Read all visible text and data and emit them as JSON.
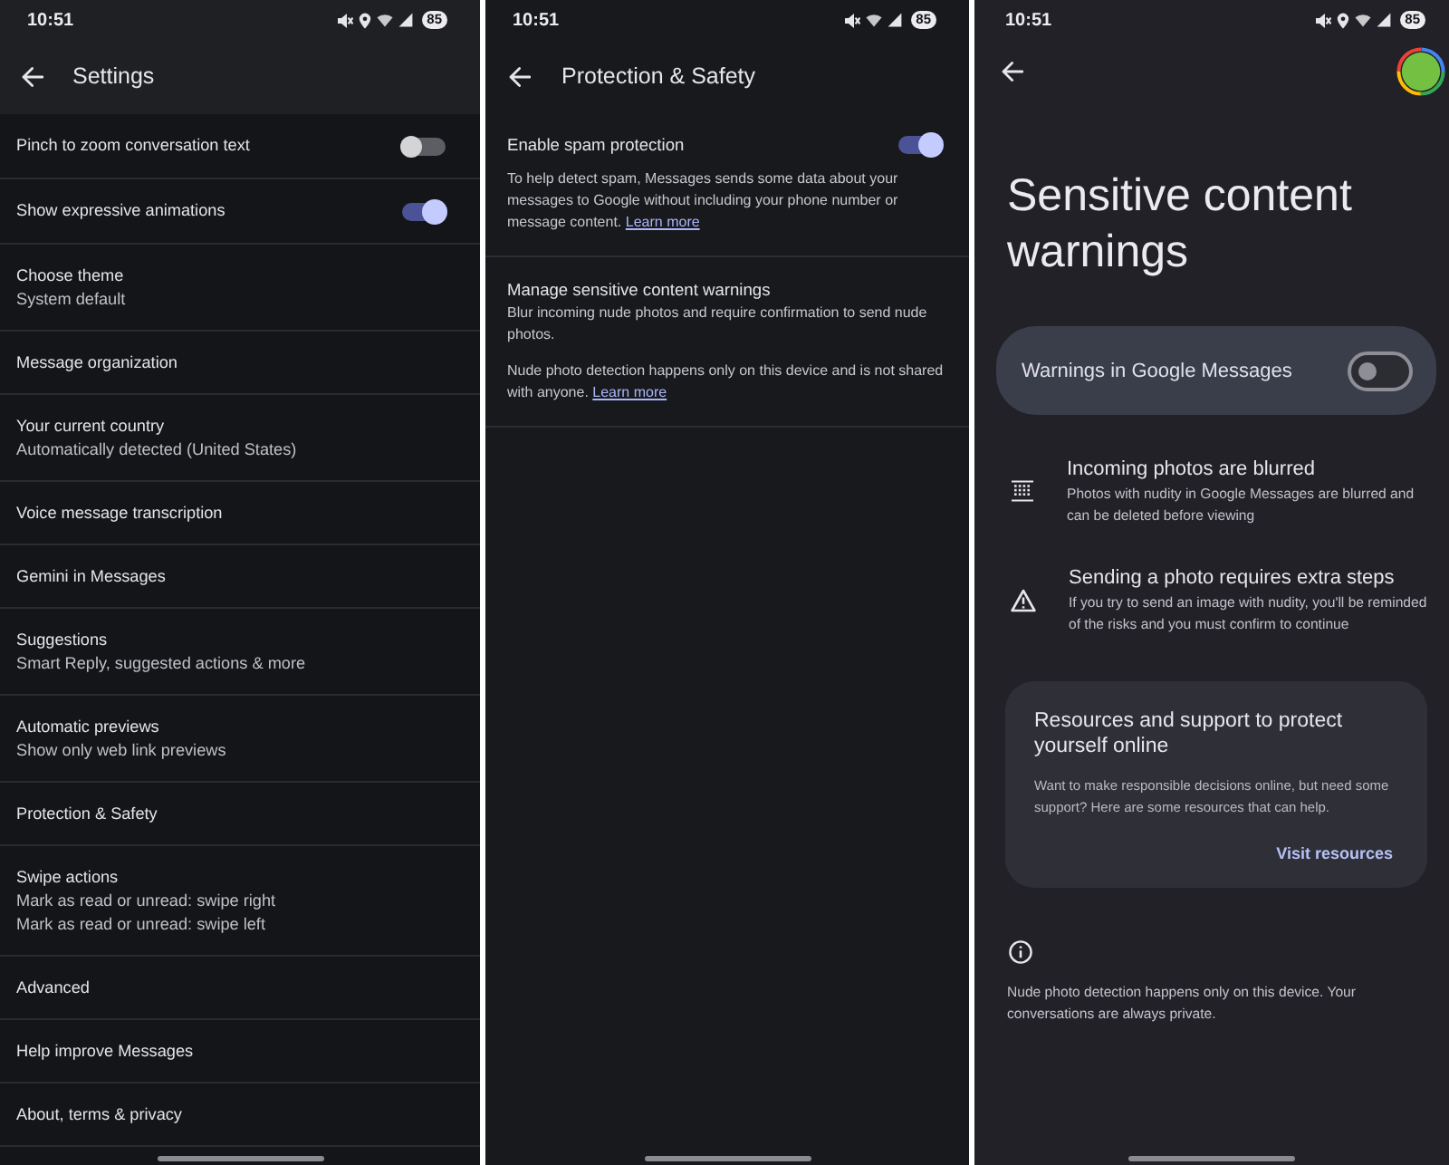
{
  "screens": [
    {
      "kind": "settings",
      "status_bar": {
        "time": "10:51",
        "location": true,
        "battery": "85"
      },
      "title": "Settings",
      "items": [
        {
          "kind": "switch",
          "title": "Pinch to zoom conversation text",
          "on": false
        },
        {
          "kind": "switch",
          "title": "Show expressive animations",
          "on": true
        },
        {
          "kind": "link",
          "title": "Choose theme",
          "summary": [
            "System default"
          ]
        },
        {
          "kind": "link",
          "title": "Message organization"
        },
        {
          "kind": "link",
          "title": "Your current country",
          "summary": [
            "Automatically detected (United States)"
          ]
        },
        {
          "kind": "link",
          "title": "Voice message transcription"
        },
        {
          "kind": "link",
          "title": "Gemini in Messages"
        },
        {
          "kind": "link",
          "title": "Suggestions",
          "summary": [
            "Smart Reply, suggested actions & more"
          ]
        },
        {
          "kind": "link",
          "title": "Automatic previews",
          "summary": [
            "Show only web link previews"
          ]
        },
        {
          "kind": "link",
          "title": "Protection & Safety"
        },
        {
          "kind": "link",
          "title": "Swipe actions",
          "summary": [
            "Mark as read or unread: swipe right",
            "Mark as read or unread: swipe left"
          ]
        },
        {
          "kind": "link",
          "title": "Advanced"
        },
        {
          "kind": "link",
          "title": "Help improve Messages"
        },
        {
          "kind": "link",
          "title": "About, terms & privacy"
        }
      ]
    },
    {
      "kind": "protection",
      "status_bar": {
        "time": "10:51",
        "location": false,
        "battery": "85"
      },
      "title": "Protection & Safety",
      "sections": [
        {
          "kind": "switch",
          "title": "Enable spam protection",
          "on": true,
          "paragraphs": [
            {
              "text": "To help detect spam, Messages sends some data about your messages to Google without including your phone number or message content.",
              "link": "Learn more"
            }
          ]
        },
        {
          "kind": "link",
          "title": "Manage sensitive content warnings",
          "paragraphs": [
            {
              "text": "Blur incoming nude photos and require confirmation to send nude photos."
            },
            {
              "text": "Nude photo detection happens only on this device and is not shared with anyone.",
              "link": "Learn more"
            }
          ]
        }
      ]
    },
    {
      "kind": "warnings",
      "status_bar": {
        "time": "10:51",
        "location": true,
        "battery": "85"
      },
      "title": "Sensitive content warnings",
      "master_switch": {
        "label": "Warnings in Google Messages",
        "on": false
      },
      "features": [
        {
          "kind": "blur",
          "title": "Incoming photos are blurred",
          "text": "Photos with nudity in Google Messages are blurred and can be deleted before viewing"
        },
        {
          "kind": "warning",
          "title": "Sending a photo requires extra steps",
          "text": "If you try to send an image with nudity, you'll be reminded of the risks and you must confirm to continue"
        }
      ],
      "resources": {
        "title": "Resources and support to protect yourself online",
        "text": "Want to make responsible decisions online, but need some support? Here are some resources that can help.",
        "action": "Visit resources"
      },
      "footnote": "Nude photo detection happens only on this device. Your conversations are always private."
    }
  ]
}
